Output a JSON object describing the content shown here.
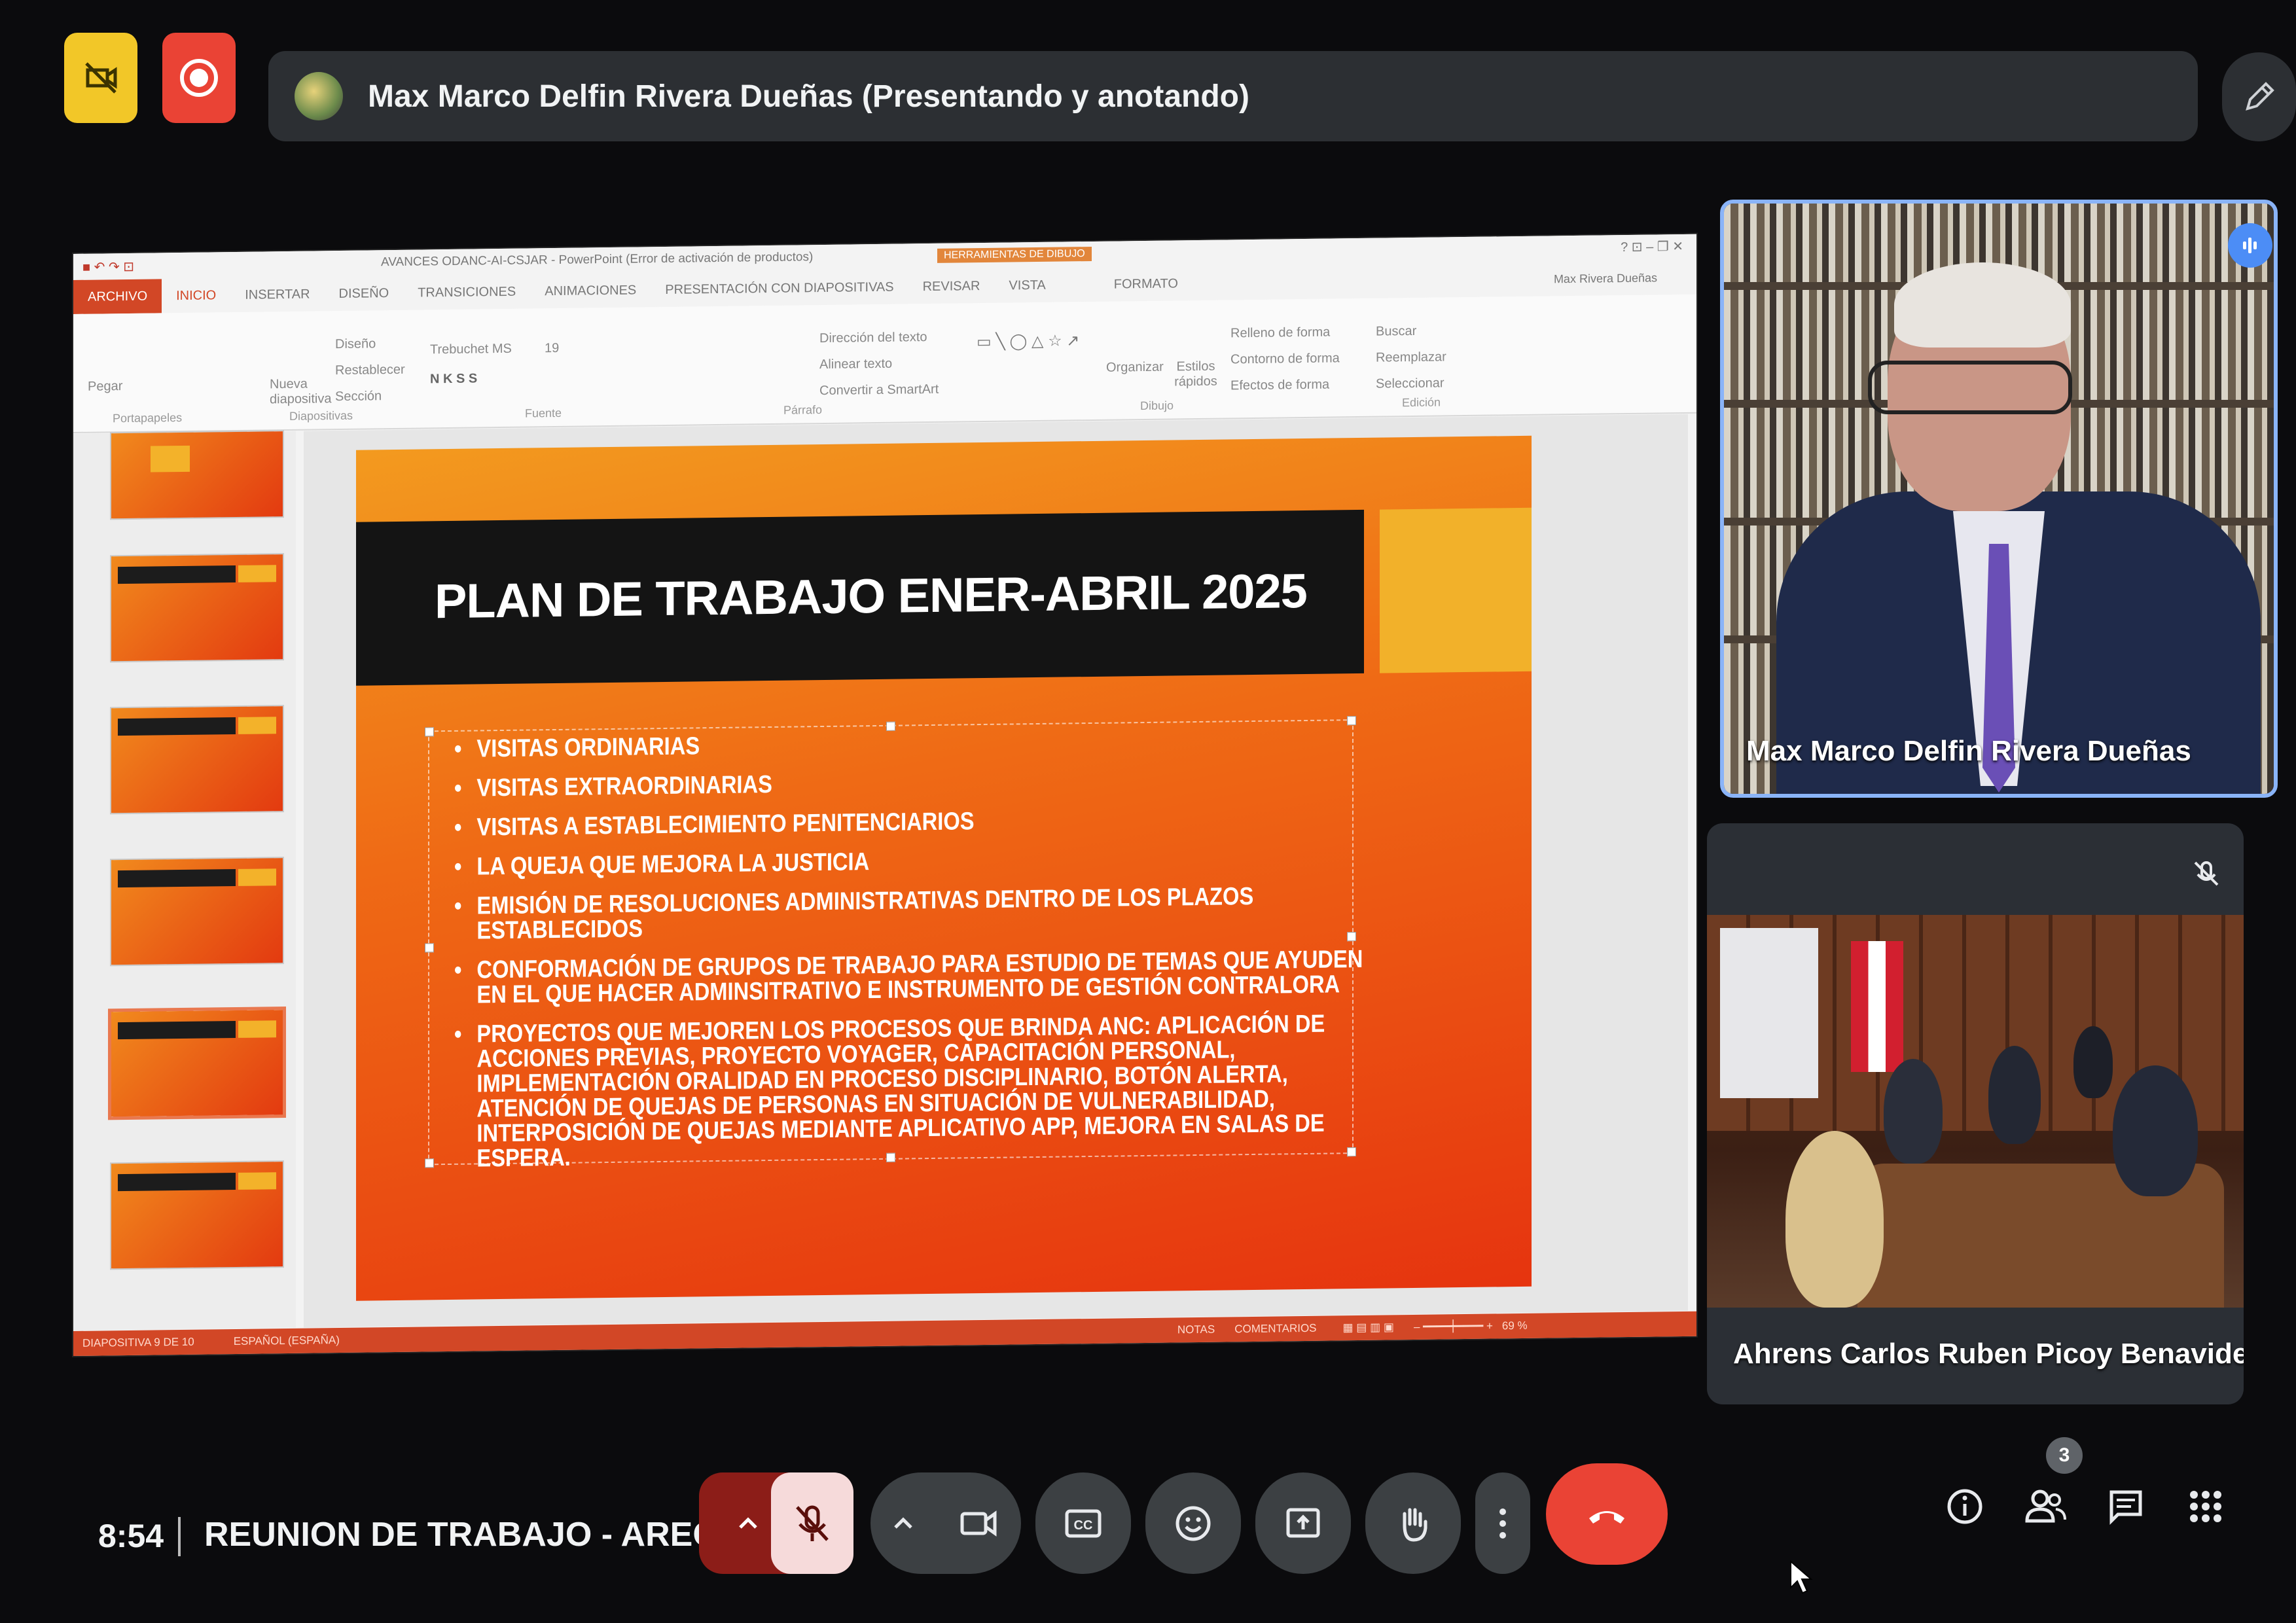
{
  "top_bar": {
    "presenter_text": "Max Marco Delfin Rivera Dueñas (Presentando y anotando)"
  },
  "ppt": {
    "window_title": "AVANCES ODANC-AI-CSJAR - PowerPoint (Error de activación de productos)",
    "tabs": [
      "ARCHIVO",
      "INICIO",
      "INSERTAR",
      "DISEÑO",
      "TRANSICIONES",
      "ANIMACIONES",
      "PRESENTACIÓN CON DIAPOSITIVAS",
      "REVISAR",
      "VISTA",
      "FORMATO"
    ],
    "tools_label": "HERRAMIENTAS DE DIBUJO",
    "user": "Max Rivera Dueñas",
    "ribbon": {
      "font_name": "Trebuchet MS",
      "font_size": "19",
      "text_direction": "Dirección del texto",
      "align_text": "Alinear texto",
      "convert_smartart": "Convertir a SmartArt",
      "organize": "Organizar",
      "quick_styles": "Estilos rápidos",
      "shape_fill": "Relleno de forma",
      "shape_outline": "Contorno de forma",
      "shape_effects": "Efectos de forma",
      "find": "Buscar",
      "replace": "Reemplazar",
      "select": "Seleccionar",
      "layout": "Diseño",
      "reset": "Restablecer",
      "section": "Sección",
      "new_slide": "Nueva diapositiva",
      "paste": "Pegar",
      "group_paragraph": "Párrafo",
      "group_drawing": "Dibujo",
      "group_editing": "Edición",
      "group_font": "Fuente",
      "group_slides": "Diapositivas",
      "group_clipboard": "Portapapeles"
    },
    "slide": {
      "title": "PLAN DE TRABAJO ENER-ABRIL 2025",
      "bullets": [
        "VISITAS ORDINARIAS",
        "VISITAS EXTRAORDINARIAS",
        "VISITAS A ESTABLECIMIENTO PENITENCIARIOS",
        "LA QUEJA QUE MEJORA LA JUSTICIA",
        "EMISIÓN DE RESOLUCIONES ADMINISTRATIVAS DENTRO DE LOS PLAZOS ESTABLECIDOS",
        "CONFORMACIÓN DE GRUPOS DE TRABAJO PARA ESTUDIO DE TEMAS QUE AYUDEN EN EL QUE HACER ADMINSITRATIVO E INSTRUMENTO DE GESTIÓN CONTRALORA",
        "PROYECTOS QUE MEJOREN LOS PROCESOS QUE BRINDA ANC: APLICACIÓN DE ACCIONES PREVIAS, PROYECTO VOYAGER, CAPACITACIÓN PERSONAL, IMPLEMENTACIÓN ORALIDAD EN PROCESO DISCIPLINARIO, BOTÓN ALERTA, ATENCIÓN DE QUEJAS DE PERSONAS EN SITUACIÓN DE VULNERABILIDAD, INTERPOSICIÓN DE QUEJAS MEDIANTE APLICATIVO APP, MEJORA EN SALAS DE ESPERA."
      ]
    },
    "status": {
      "slide_count": "DIAPOSITIVA 9 DE 10",
      "language": "ESPAÑOL (ESPAÑA)",
      "notes": "NOTAS",
      "comments": "COMENTARIOS",
      "zoom": "69 %"
    }
  },
  "participants": {
    "tile1_name": "Max Marco Delfin Rivera Dueñas",
    "tile2_name": "Ahrens Carlos Ruben Picoy Benavides",
    "count": "3"
  },
  "bottom": {
    "time": "8:54",
    "meeting_title": "REUNION DE TRABAJO - AREQUI..."
  },
  "colors": {
    "accent_blue": "#8ab4f8",
    "end_call": "#ea4335",
    "mic_warning": "#8c1d18",
    "ppt_orange": "#d24726"
  }
}
